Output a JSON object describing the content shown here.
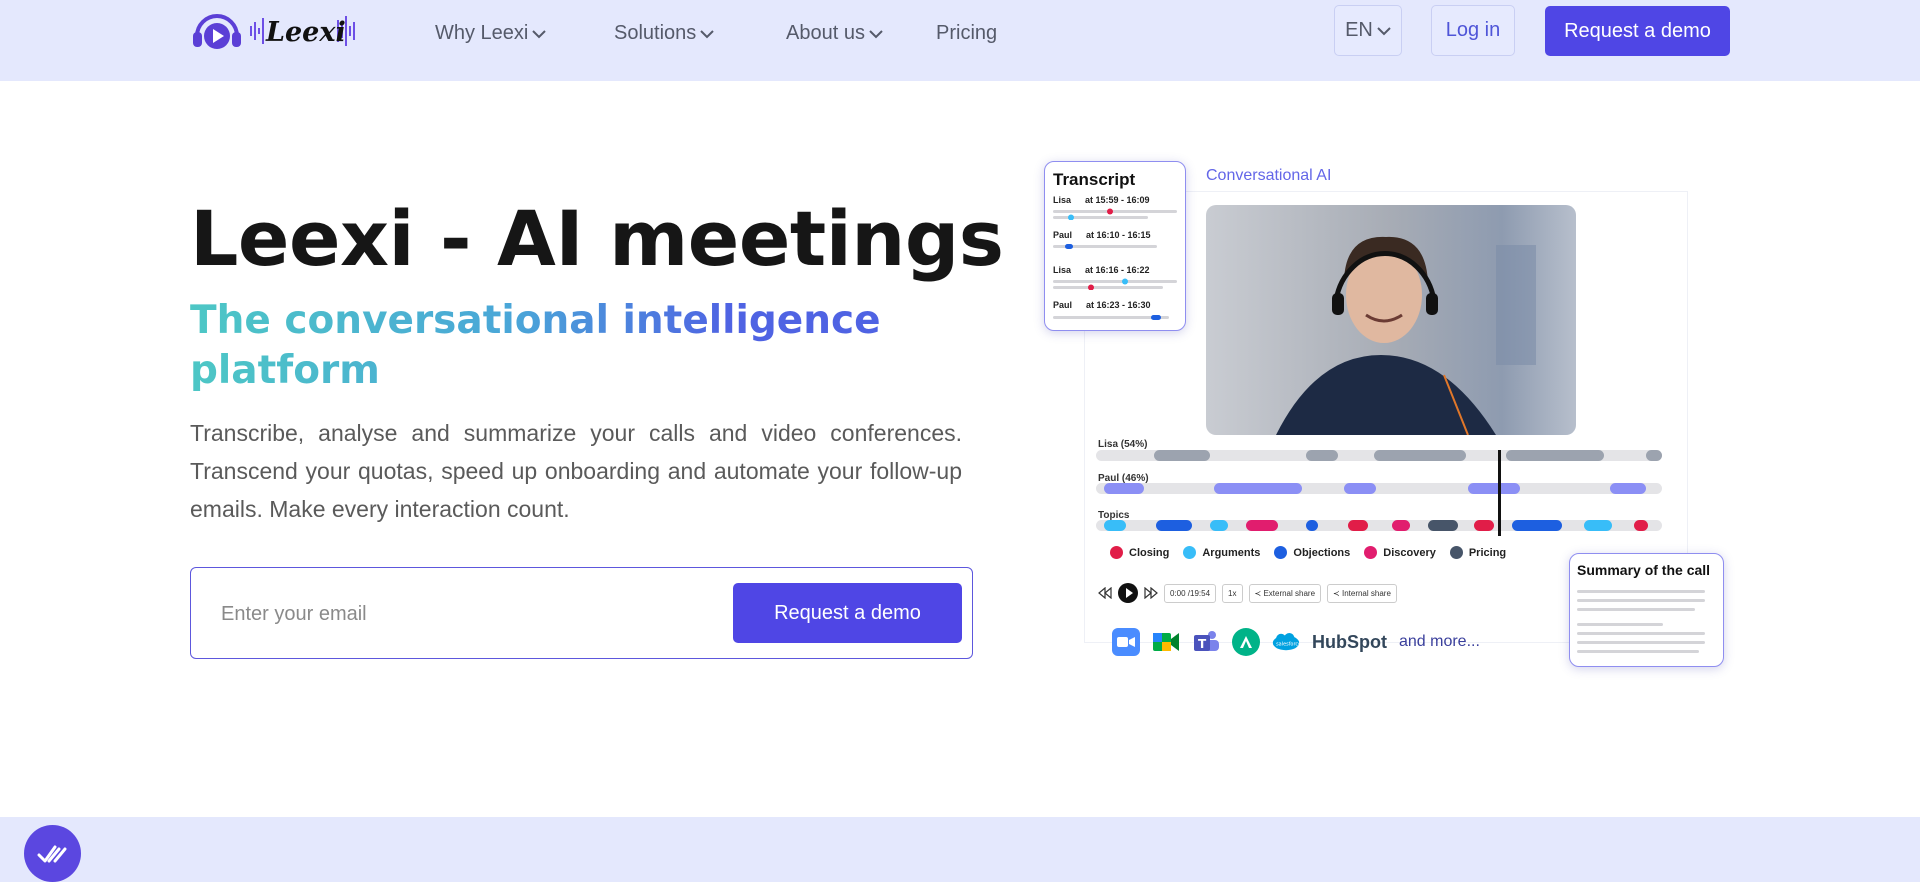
{
  "brand": {
    "name": "Leexi",
    "accent": "#4f46e5",
    "header_bg": "#e4e8fd"
  },
  "nav": {
    "items": [
      {
        "label": "Why Leexi",
        "dropdown": true
      },
      {
        "label": "Solutions",
        "dropdown": true
      },
      {
        "label": "About us",
        "dropdown": true
      },
      {
        "label": "Pricing",
        "dropdown": false
      }
    ],
    "language": "EN",
    "login": "Log in",
    "cta": "Request a demo"
  },
  "hero": {
    "title": "Leexi - AI meetings",
    "subtitle": "The conversational intelligence platform",
    "description": "Transcribe, analyse and summarize your calls and video conferences. Transcend your quotas, speed up onboarding and automate your follow-up emails. Make every interaction count.",
    "email_placeholder": "Enter your email",
    "cta": "Request a demo"
  },
  "illustration": {
    "panel_label": "Conversational AI",
    "transcript": {
      "title": "Transcript",
      "rows": [
        {
          "speaker": "Lisa",
          "time": "at 15:59 - 16:09"
        },
        {
          "speaker": "Paul",
          "time": "at 16:10 - 16:15"
        },
        {
          "speaker": "Lisa",
          "time": "at 16:16 - 16:22"
        },
        {
          "speaker": "Paul",
          "time": "at 16:23 - 16:30"
        }
      ]
    },
    "tracks": {
      "speaker1": "Lisa (54%)",
      "speaker2": "Paul (46%)",
      "topics": "Topics"
    },
    "topics": [
      {
        "label": "Closing",
        "color": "#e11d48"
      },
      {
        "label": "Arguments",
        "color": "#38bdf8"
      },
      {
        "label": "Objections",
        "color": "#1d5fe0"
      },
      {
        "label": "Discovery",
        "color": "#e11d6e"
      },
      {
        "label": "Pricing",
        "color": "#475569"
      }
    ],
    "player": {
      "time": "0:00 /19:54",
      "speed": "1x",
      "external_share": "External share",
      "internal_share": "Internal share"
    },
    "integrations": {
      "icons": [
        "zoom-icon",
        "google-meet-icon",
        "teams-icon",
        "aircall-icon",
        "salesforce-icon"
      ],
      "hubspot": "HubSpot",
      "more": "and more..."
    },
    "summary_title": "Summary of the call"
  }
}
